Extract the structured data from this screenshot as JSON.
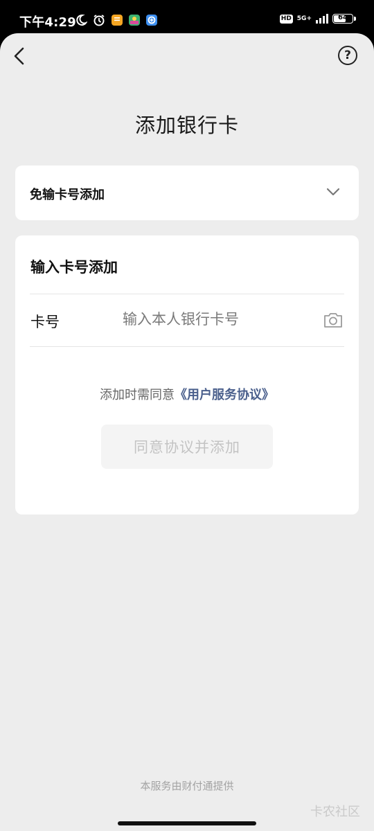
{
  "status_bar": {
    "time": "下午4:29",
    "network": "5G+",
    "hd": "HD",
    "battery": "64",
    "battery_level_percent": 64,
    "icons": [
      "moon-icon",
      "alarm-icon",
      "notes-app-icon",
      "game-app-icon",
      "app-icon"
    ]
  },
  "page": {
    "title": "添加银行卡",
    "help_icon": "?"
  },
  "quick_add": {
    "label": "免输卡号添加"
  },
  "manual_add": {
    "title": "输入卡号添加",
    "card_label": "卡号",
    "card_placeholder": "输入本人银行卡号",
    "agree_prefix": "添加时需同意",
    "agreement_link": "《用户服务协议》",
    "submit_label": "同意协议并添加"
  },
  "footer": {
    "provider": "本服务由财付通提供",
    "watermark": "卡农社区"
  },
  "colors": {
    "background": "#ededed",
    "card": "#ffffff",
    "link": "#4a5f8c",
    "disabled_text": "#c3c3c3"
  }
}
